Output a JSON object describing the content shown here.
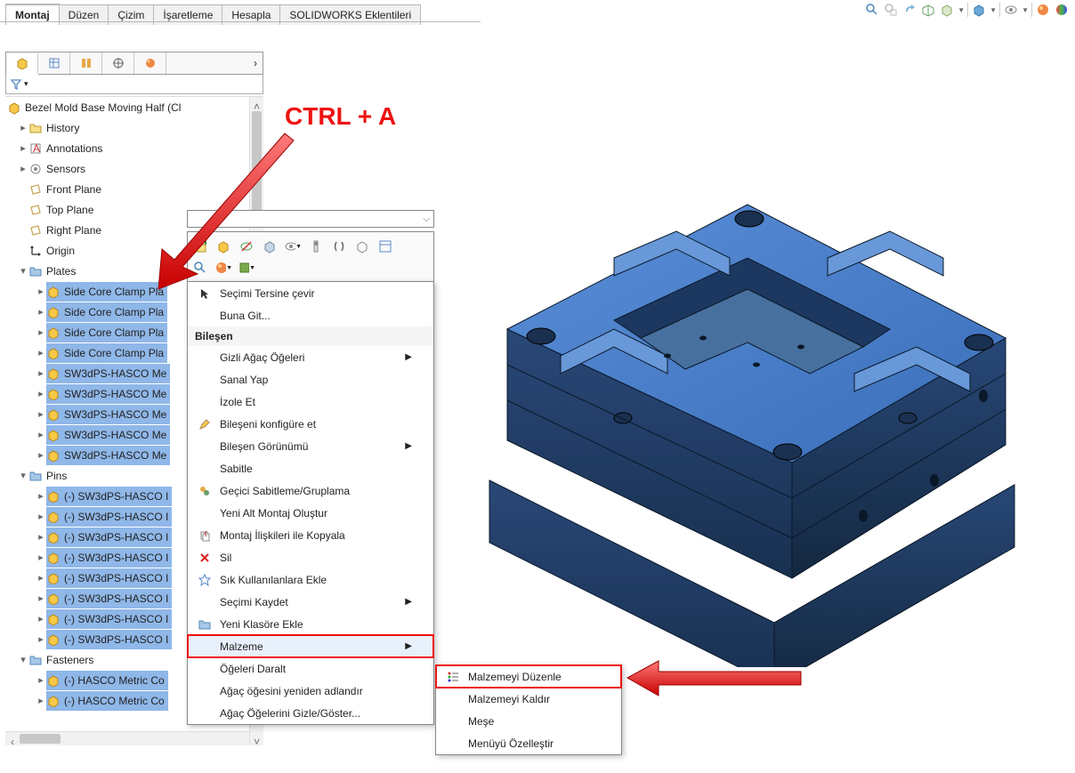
{
  "tabs": {
    "items": [
      "Montaj",
      "Düzen",
      "Çizim",
      "İşaretleme",
      "Hesapla",
      "SOLIDWORKS Eklentileri"
    ],
    "active": 0
  },
  "anno": {
    "ctrl_a": "CTRL + A"
  },
  "root": "Bezel Mold Base Moving Half  (Cl",
  "tree_top": [
    {
      "label": "History",
      "icon": "history"
    },
    {
      "label": "Annotations",
      "icon": "anno"
    },
    {
      "label": "Sensors",
      "icon": "sensors"
    },
    {
      "label": "Front Plane",
      "icon": "plane"
    },
    {
      "label": "Top Plane",
      "icon": "plane"
    },
    {
      "label": "Right Plane",
      "icon": "plane"
    },
    {
      "label": "Origin",
      "icon": "origin"
    }
  ],
  "folders": {
    "plates": {
      "label": "Plates",
      "items": [
        "Side Core Clamp Pla",
        "Side Core Clamp Pla",
        "Side Core Clamp Pla",
        "Side Core Clamp Pla",
        "SW3dPS-HASCO Me",
        "SW3dPS-HASCO Me",
        "SW3dPS-HASCO Me",
        "SW3dPS-HASCO Me",
        "SW3dPS-HASCO Me"
      ]
    },
    "pins": {
      "label": "Pins",
      "items": [
        "(-) SW3dPS-HASCO I",
        "(-) SW3dPS-HASCO I",
        "(-) SW3dPS-HASCO I",
        "(-) SW3dPS-HASCO I",
        "(-) SW3dPS-HASCO I",
        "(-) SW3dPS-HASCO I",
        "(-) SW3dPS-HASCO I",
        "(-) SW3dPS-HASCO I"
      ]
    },
    "fasteners": {
      "label": "Fasteners",
      "items": [
        "(-) HASCO Metric Co",
        "(-) HASCO Metric Co"
      ]
    }
  },
  "ctx_menu": {
    "upper": [
      {
        "label": "Seçimi Tersine çevir",
        "icon": "cursor",
        "u": "T"
      },
      {
        "label": "Buna Git...",
        "icon": "",
        "u": "B"
      }
    ],
    "section": "Bileşen",
    "items": [
      {
        "label": "Gizli Ağaç Öğeleri",
        "sub": true
      },
      {
        "label": "Sanal Yap",
        "u": "S"
      },
      {
        "label": "İzole Et",
        "u": "İ"
      },
      {
        "label": "Bileşeni konfigüre et",
        "icon": "edit",
        "u": "l"
      },
      {
        "label": "Bileşen Görünümü",
        "sub": true,
        "u": "n"
      },
      {
        "label": "Sabitle",
        "u": "t"
      },
      {
        "label": "Geçici Sabitleme/Gruplama",
        "icon": "group",
        "u": "c"
      },
      {
        "label": "Yeni Alt Montaj Oluştur",
        "u": "Y"
      },
      {
        "label": "Montaj İlişkileri ile Kopyala",
        "icon": "copy"
      },
      {
        "label": "Sil",
        "icon": "delete"
      },
      {
        "label": "Sık Kullanılanlara Ekle",
        "icon": "star"
      },
      {
        "label": "Seçimi Kaydet",
        "sub": true
      },
      {
        "label": "Yeni Klasöre Ekle",
        "icon": "folder",
        "u": "o"
      },
      {
        "label": "Malzeme",
        "sub": true,
        "hl": true,
        "boxed": true
      },
      {
        "label": "Öğeleri Daralt",
        "u": "Ö"
      },
      {
        "label": "Ağaç öğesini yeniden adlandır"
      },
      {
        "label": "Ağaç Öğelerini Gizle/Göster...",
        "u": "G"
      }
    ]
  },
  "sub_menu": {
    "items": [
      {
        "label": "Malzemeyi Düzenle",
        "icon": "list",
        "boxed": true,
        "u": "a"
      },
      {
        "label": "Malzemeyi Kaldır",
        "u": "l"
      },
      {
        "label": "Meşe",
        "u": "ş"
      },
      {
        "label": "Menüyü Özelleştir",
        "u": "M"
      }
    ]
  }
}
